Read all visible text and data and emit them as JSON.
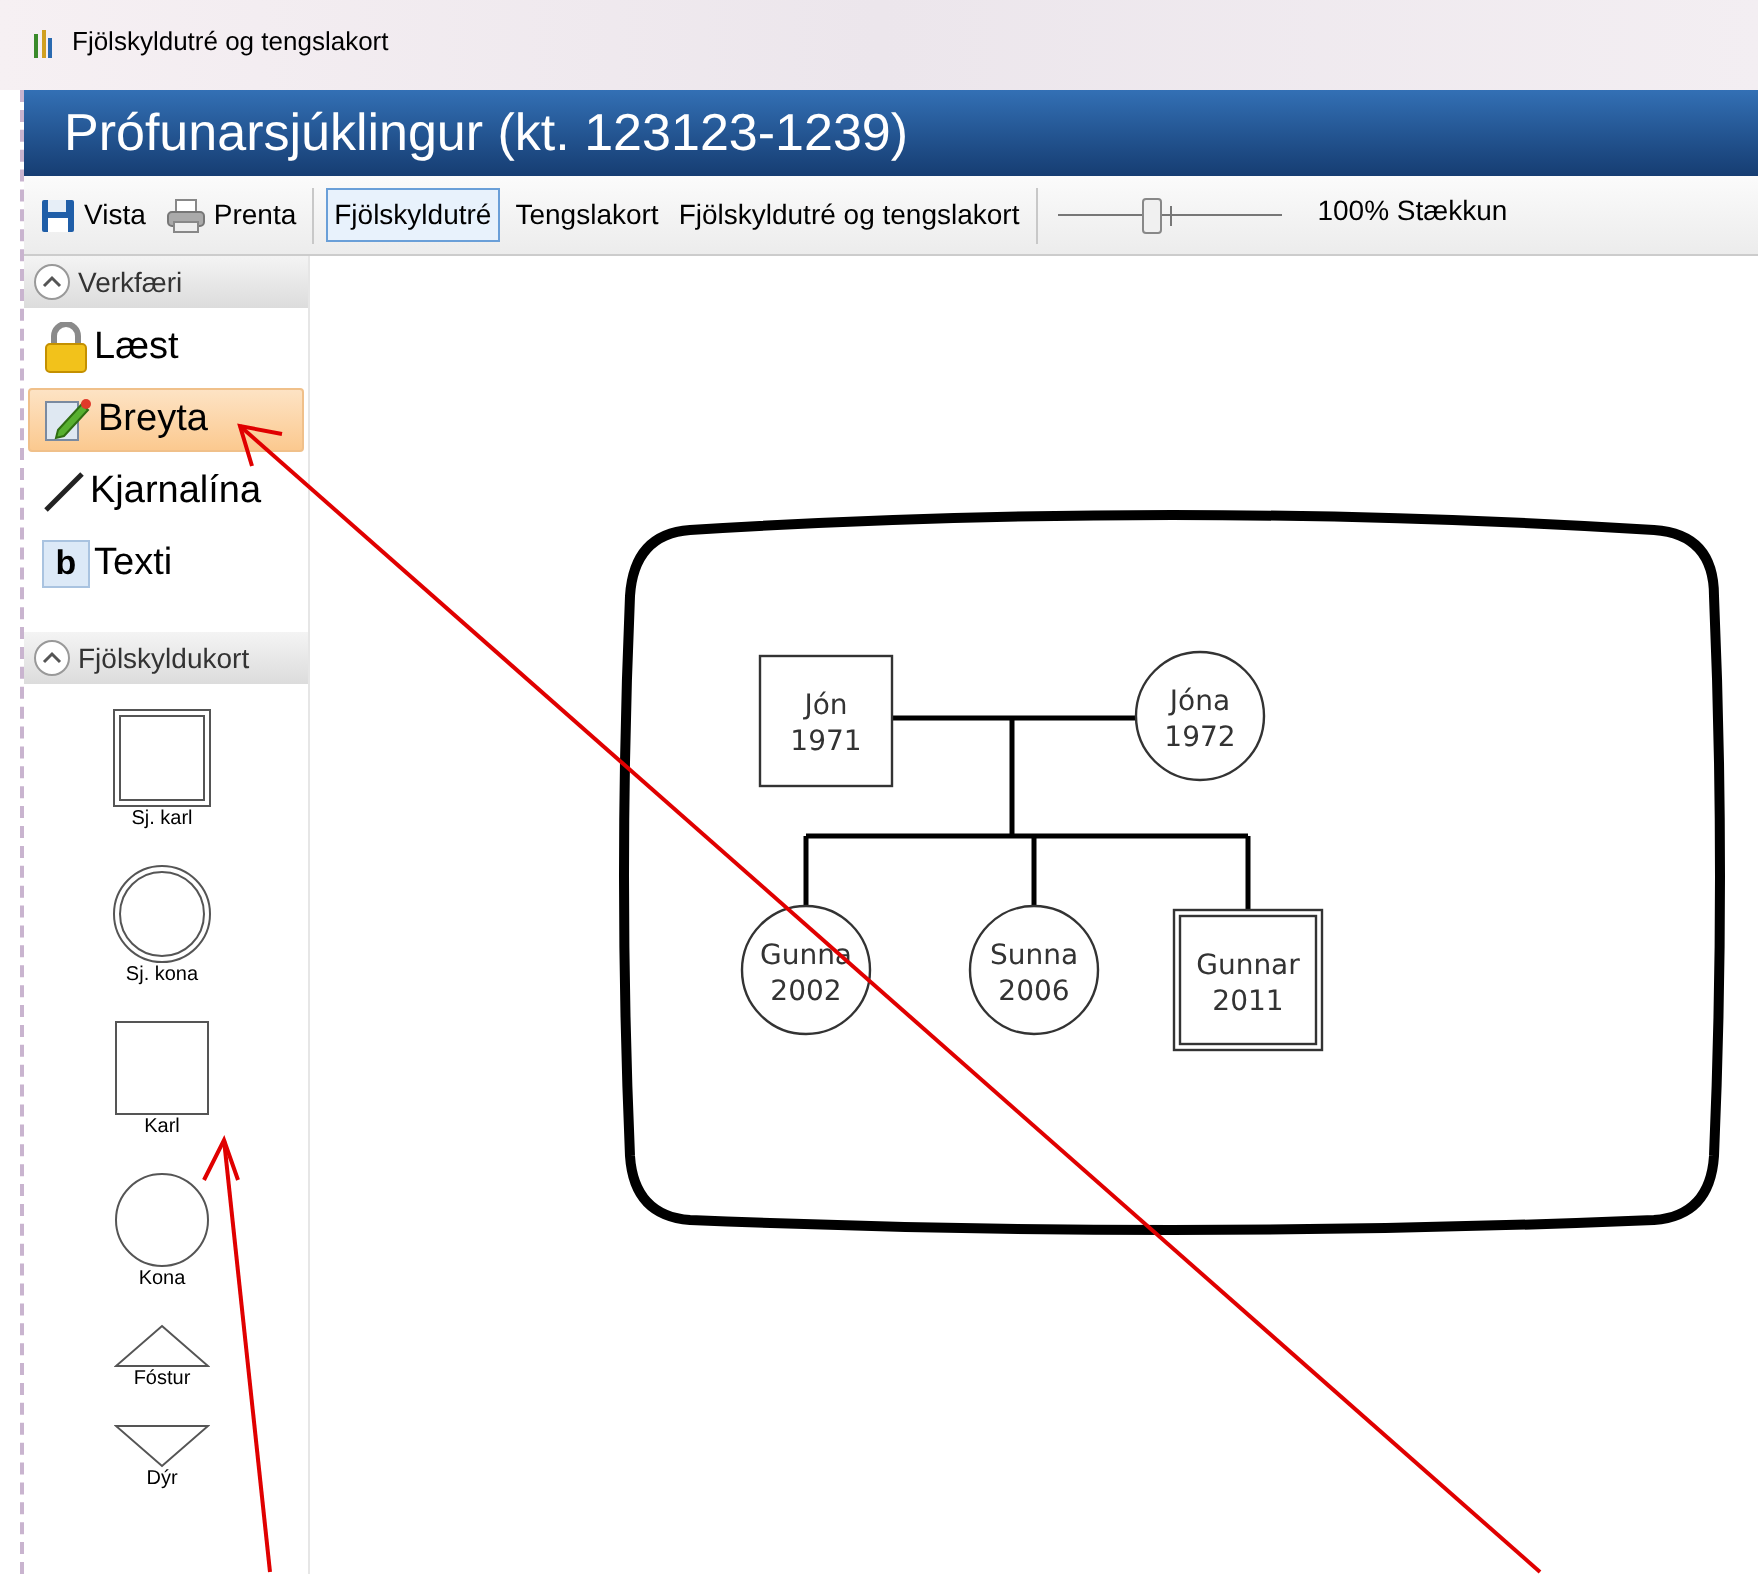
{
  "window": {
    "title": "Fjölskyldutré og tengslakort"
  },
  "header": {
    "title": "Prófunarsjúklingur (kt. 123123-1239)"
  },
  "toolbar": {
    "actions": [
      {
        "label": "Vista",
        "kind": "save"
      },
      {
        "label": "Prenta",
        "kind": "print"
      }
    ],
    "tabs": [
      {
        "label": "Fjölskyldutré",
        "selected": true
      },
      {
        "label": "Tengslakort",
        "selected": false
      },
      {
        "label": "Fjölskyldutré og tengslakort",
        "selected": false
      }
    ],
    "zoom": {
      "level": 0.42,
      "reading": "100% Stækkun"
    }
  },
  "sidebar": {
    "tools": {
      "title": "Verkfæri",
      "expanded": true,
      "items": [
        {
          "label": "Læst",
          "kind": "lock",
          "selected": false
        },
        {
          "label": "Breyta",
          "kind": "edit",
          "selected": true
        },
        {
          "label": "Kjarnalína",
          "kind": "line",
          "selected": false
        },
        {
          "label": "Texti",
          "kind": "text",
          "icon_text": "b",
          "selected": false
        }
      ]
    },
    "shapes": {
      "title": "Fjölskyldukort",
      "expanded": true,
      "items": [
        {
          "label": "Sj. karl",
          "kind": "double-square"
        },
        {
          "label": "Sj. kona",
          "kind": "double-circle"
        },
        {
          "label": "Karl",
          "kind": "square"
        },
        {
          "label": "Kona",
          "kind": "circle"
        },
        {
          "label": "Fóstur",
          "kind": "triangle"
        },
        {
          "label": "Dýr",
          "kind": "inverted-triangle"
        }
      ]
    }
  },
  "family_chart": {
    "parents": [
      {
        "name": "Jón",
        "year": "1971",
        "kind": "square"
      },
      {
        "name": "Jóna",
        "year": "1972",
        "kind": "circle"
      }
    ],
    "children": [
      {
        "name": "Gunna",
        "year": "2002",
        "kind": "circle"
      },
      {
        "name": "Sunna",
        "year": "2006",
        "kind": "circle"
      },
      {
        "name": "Gunnar",
        "year": "2011",
        "kind": "double-square"
      }
    ]
  }
}
